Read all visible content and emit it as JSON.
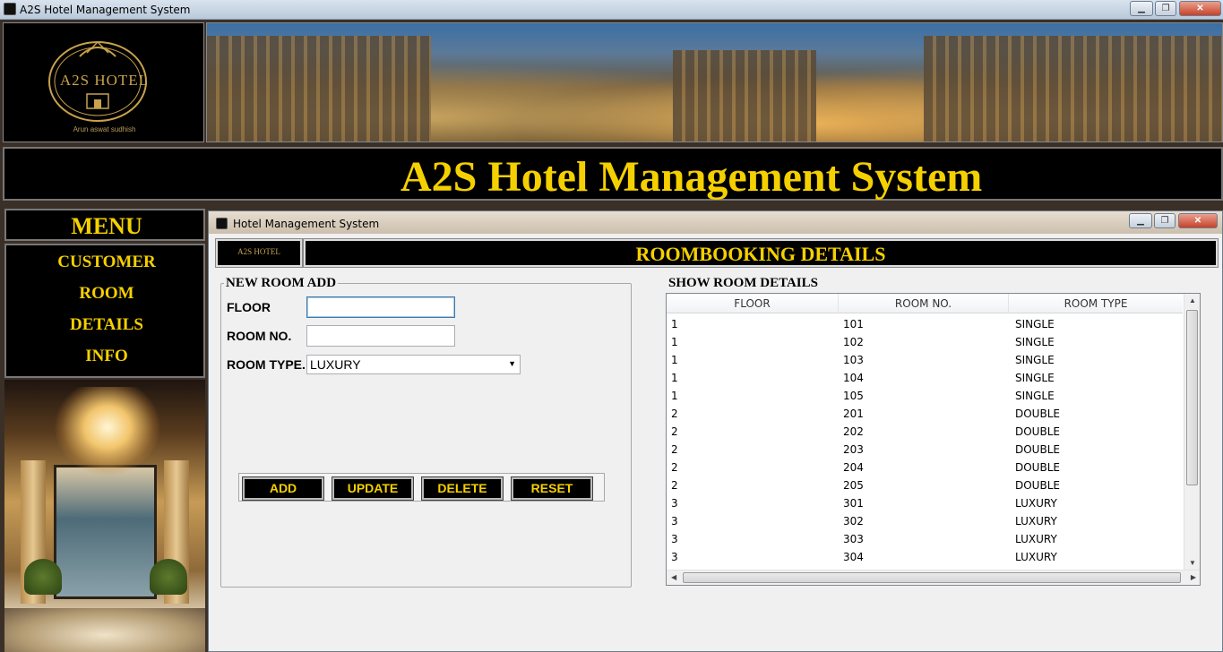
{
  "window": {
    "title": "A2S Hotel Management System"
  },
  "header": {
    "logo_text": "A2S HOTEL",
    "logo_subtitle": "Arun aswat sudhish",
    "system_title": "A2S Hotel Management System"
  },
  "menu": {
    "title": "MENU",
    "items": [
      {
        "label": "CUSTOMER"
      },
      {
        "label": "ROOM"
      },
      {
        "label": "DETAILS"
      },
      {
        "label": "INFO"
      }
    ]
  },
  "inner_window": {
    "title": "Hotel Management System",
    "logo_text": "A2S HOTEL",
    "heading": "ROOMBOOKING DETAILS"
  },
  "new_room": {
    "legend": "NEW ROOM ADD",
    "floor_label": "FLOOR",
    "floor_value": "",
    "room_no_label": "ROOM NO.",
    "room_no_value": "",
    "room_type_label": "ROOM TYPE.",
    "room_type_value": "LUXURY",
    "buttons": {
      "add": "ADD",
      "update": "UPDATE",
      "delete": "DELETE",
      "reset": "RESET"
    }
  },
  "show_rooms": {
    "legend": "SHOW ROOM DETAILS",
    "columns": [
      "FLOOR",
      "ROOM NO.",
      "ROOM TYPE"
    ],
    "rows": [
      [
        "1",
        "101",
        "SINGLE"
      ],
      [
        "1",
        "102",
        "SINGLE"
      ],
      [
        "1",
        "103",
        "SINGLE"
      ],
      [
        "1",
        "104",
        "SINGLE"
      ],
      [
        "1",
        "105",
        "SINGLE"
      ],
      [
        "2",
        "201",
        "DOUBLE"
      ],
      [
        "2",
        "202",
        "DOUBLE"
      ],
      [
        "2",
        "203",
        "DOUBLE"
      ],
      [
        "2",
        "204",
        "DOUBLE"
      ],
      [
        "2",
        "205",
        "DOUBLE"
      ],
      [
        "3",
        "301",
        "LUXURY"
      ],
      [
        "3",
        "302",
        "LUXURY"
      ],
      [
        "3",
        "303",
        "LUXURY"
      ],
      [
        "3",
        "304",
        "LUXURY"
      ]
    ]
  },
  "colors": {
    "accent_yellow": "#f5d000",
    "panel_black": "#000000",
    "gold": "#c8a24c"
  }
}
